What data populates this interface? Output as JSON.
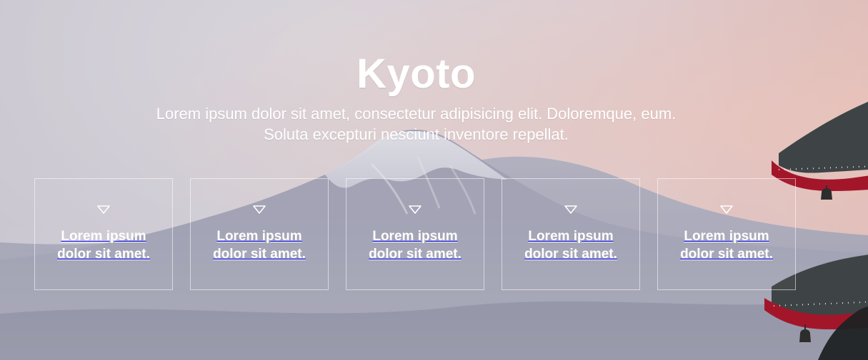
{
  "hero": {
    "title": "Kyoto",
    "subtitle_line1": "Lorem ipsum dolor sit amet, consectetur adipisicing elit. Doloremque, eum.",
    "subtitle_line2": "Soluta excepturi nesciunt inventore repellat."
  },
  "cards": [
    {
      "icon": "triangle-down-outline-icon",
      "label_line1": "Lorem ipsum",
      "label_line2": "dolor sit amet."
    },
    {
      "icon": "triangle-down-outline-icon",
      "label_line1": "Lorem ipsum",
      "label_line2": "dolor sit amet."
    },
    {
      "icon": "triangle-down-outline-icon",
      "label_line1": "Lorem ipsum",
      "label_line2": "dolor sit amet."
    },
    {
      "icon": "triangle-down-outline-icon",
      "label_line1": "Lorem ipsum",
      "label_line2": "dolor sit amet."
    },
    {
      "icon": "triangle-down-outline-icon",
      "label_line1": "Lorem ipsum",
      "label_line2": "dolor sit amet."
    }
  ],
  "colors": {
    "text": "#ffffff",
    "card_border": "#ffffff",
    "sky_left": "#d8d4dc",
    "sky_right": "#efc9c3"
  }
}
